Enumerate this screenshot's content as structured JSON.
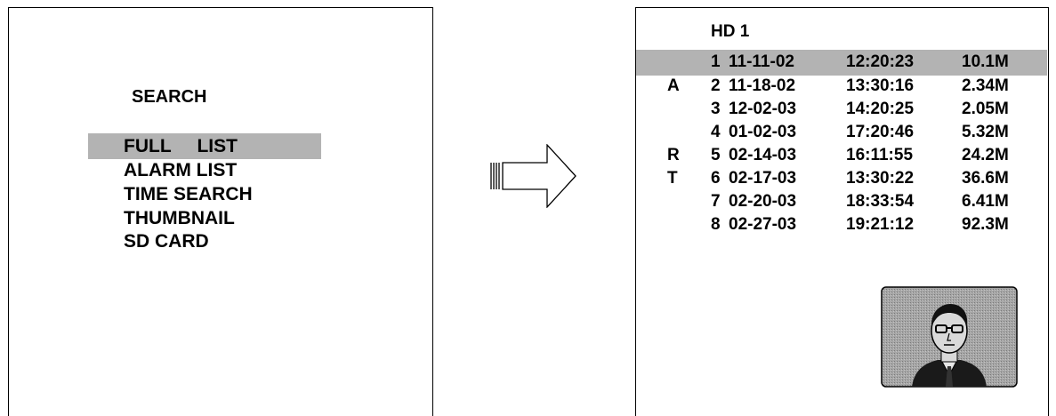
{
  "search_menu": {
    "title": "SEARCH",
    "items": [
      {
        "label": "FULL     LIST",
        "selected": true
      },
      {
        "label": "ALARM LIST",
        "selected": false
      },
      {
        "label": "TIME SEARCH",
        "selected": false
      },
      {
        "label": "THUMBNAIL",
        "selected": false
      },
      {
        "label": "SD CARD",
        "selected": false
      }
    ]
  },
  "file_list": {
    "title": "HD 1",
    "rows": [
      {
        "flag": "",
        "index": "1",
        "date": "11-11-02",
        "time": "12:20:23",
        "size": "10.1M",
        "selected": true
      },
      {
        "flag": "A",
        "index": "2",
        "date": "11-18-02",
        "time": "13:30:16",
        "size": "2.34M",
        "selected": false
      },
      {
        "flag": "",
        "index": "3",
        "date": "12-02-03",
        "time": "14:20:25",
        "size": "2.05M",
        "selected": false
      },
      {
        "flag": "",
        "index": "4",
        "date": "01-02-03",
        "time": "17:20:46",
        "size": "5.32M",
        "selected": false
      },
      {
        "flag": "R",
        "index": "5",
        "date": "02-14-03",
        "time": "16:11:55",
        "size": "24.2M",
        "selected": false
      },
      {
        "flag": "T",
        "index": "6",
        "date": "02-17-03",
        "time": "13:30:22",
        "size": "36.6M",
        "selected": false
      },
      {
        "flag": "",
        "index": "7",
        "date": "02-20-03",
        "time": "18:33:54",
        "size": "6.41M",
        "selected": false
      },
      {
        "flag": "",
        "index": "8",
        "date": "02-27-03",
        "time": "19:21:12",
        "size": "92.3M",
        "selected": false
      }
    ]
  },
  "icons": {
    "arrow": "right-arrow-icon",
    "thumbnail": "person-thumbnail-icon"
  },
  "colors": {
    "highlight": "#b3b3b3",
    "thumbnail_bg": "#a6a6a6"
  }
}
